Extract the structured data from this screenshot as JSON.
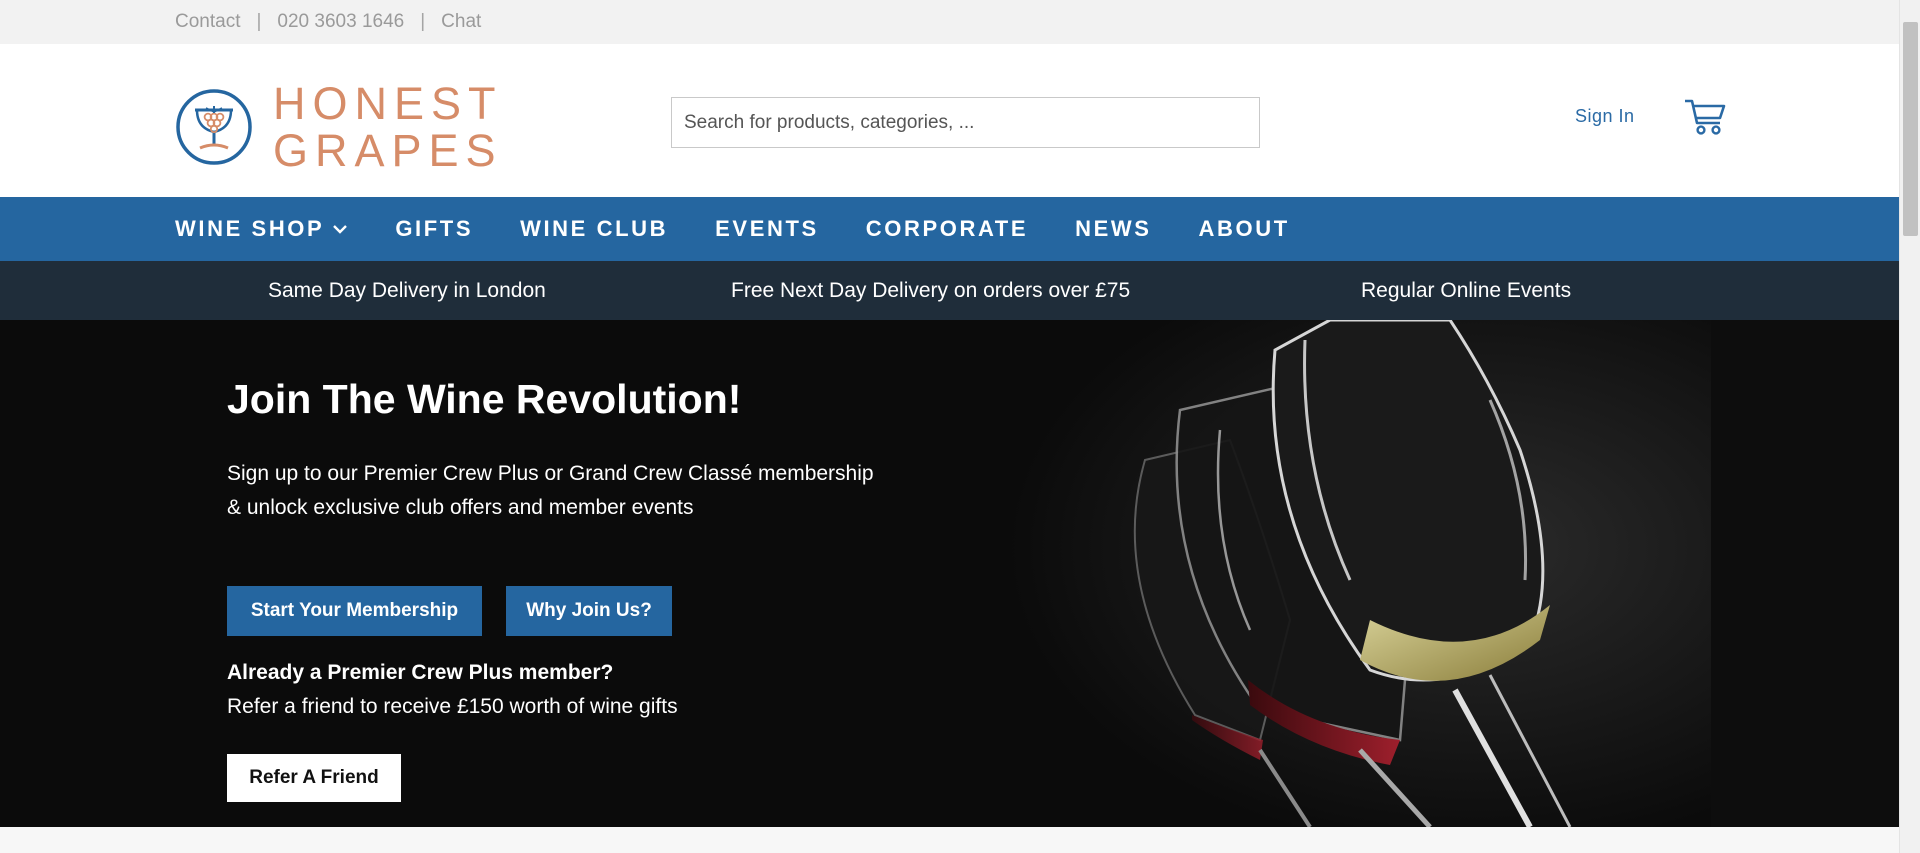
{
  "utility": {
    "contact": "Contact",
    "phone": "020 3603 1646",
    "chat": "Chat",
    "separator": "|"
  },
  "brand": {
    "name_line1": "HONEST",
    "name_line2": "GRAPES",
    "logo_icon": "grapes-chalice-icon",
    "color": "#d68c68"
  },
  "search": {
    "placeholder": "Search for products, categories, ..."
  },
  "account": {
    "signin": "Sign In",
    "cart_icon": "shopping-cart-icon"
  },
  "nav": {
    "items": [
      "WINE SHOP",
      "GIFTS",
      "WINE CLUB",
      "EVENTS",
      "CORPORATE",
      "NEWS",
      "ABOUT"
    ],
    "dropdown_icon": "chevron-down-icon",
    "bg": "#2566a0"
  },
  "usp": {
    "items": [
      "Same Day Delivery in London",
      "Free Next Day Delivery on orders over £75",
      "Regular Online Events"
    ],
    "bg": "#1f2d3a"
  },
  "hero": {
    "title": "Join The Wine Revolution!",
    "body": "Sign up to our Premier Crew Plus or Grand Crew Classé membership & unlock exclusive club offers and member events",
    "start_button": "Start Your Membership",
    "why_button": "Why Join Us?",
    "already": "Already a Premier Crew Plus member?",
    "refer_text": "Refer a friend to receive £150 worth of wine gifts",
    "refer_button": "Refer A Friend",
    "image": "wine-glasses-image"
  }
}
